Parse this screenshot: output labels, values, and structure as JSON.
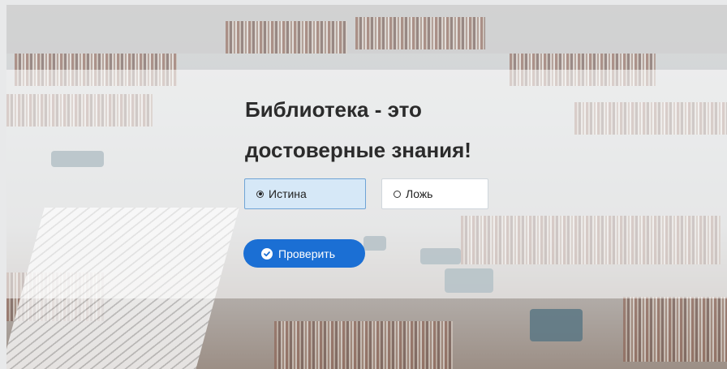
{
  "quiz": {
    "question_line1": "Библиотека - это",
    "question_line2": "достоверные знания!",
    "options": [
      {
        "label": "Истина",
        "selected": true
      },
      {
        "label": "Ложь",
        "selected": false
      }
    ],
    "check_button_label": "Проверить",
    "check_icon": "check-circle-icon"
  },
  "colors": {
    "accent": "#1b6fd4",
    "selected_option_bg": "#d6e8f7"
  }
}
